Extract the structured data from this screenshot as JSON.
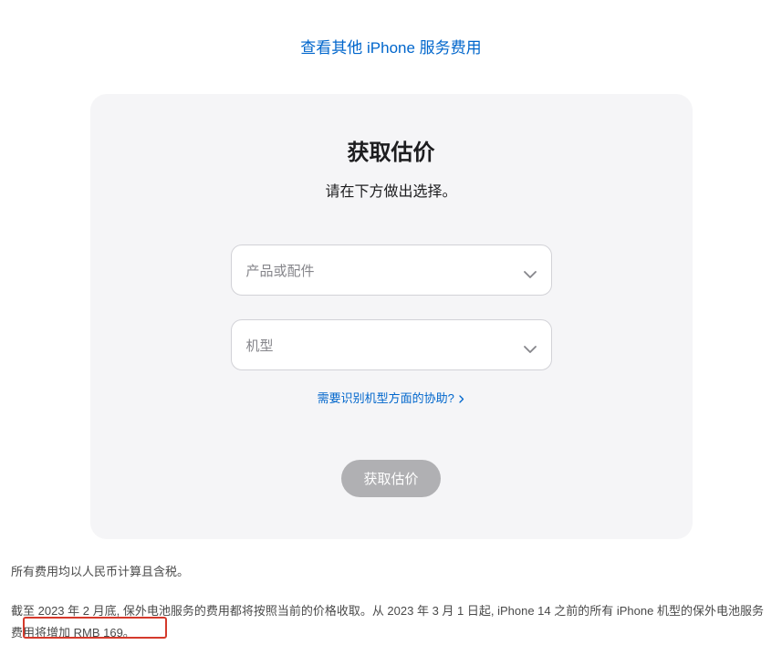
{
  "top_link": {
    "text": "查看其他 iPhone 服务费用"
  },
  "card": {
    "title": "获取估价",
    "subtitle": "请在下方做出选择。",
    "select_product_placeholder": "产品或配件",
    "select_model_placeholder": "机型",
    "help_link_text": "需要识别机型方面的协助?",
    "submit_button": "获取估价"
  },
  "footer": {
    "note1": "所有费用均以人民币计算且含税。",
    "note2": "截至 2023 年 2 月底, 保外电池服务的费用都将按照当前的价格收取。从 2023 年 3 月 1 日起, iPhone 14 之前的所有 iPhone 机型的保外电池服务费用将增加 RMB 169。"
  }
}
